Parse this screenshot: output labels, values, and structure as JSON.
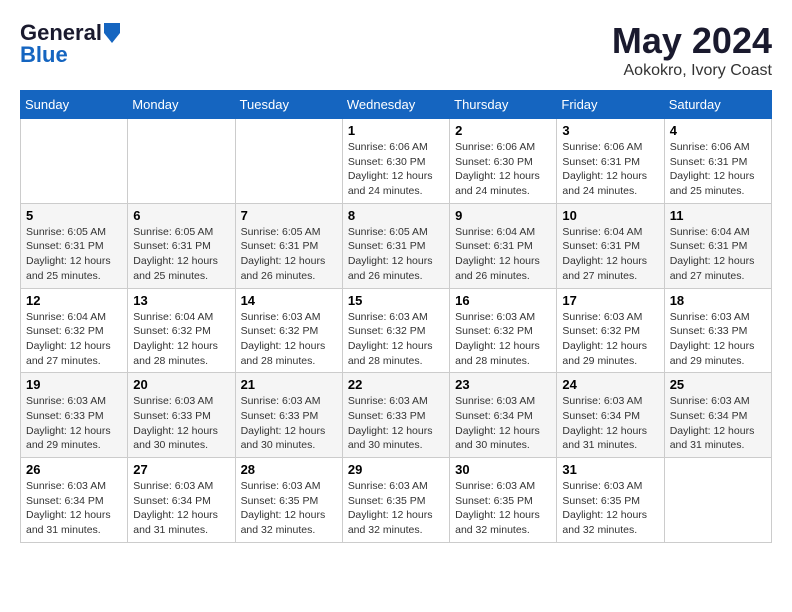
{
  "header": {
    "logo_general": "General",
    "logo_blue": "Blue",
    "month_year": "May 2024",
    "location": "Aokokro, Ivory Coast"
  },
  "days_of_week": [
    "Sunday",
    "Monday",
    "Tuesday",
    "Wednesday",
    "Thursday",
    "Friday",
    "Saturday"
  ],
  "weeks": [
    [
      {
        "day": "",
        "info": ""
      },
      {
        "day": "",
        "info": ""
      },
      {
        "day": "",
        "info": ""
      },
      {
        "day": "1",
        "info": "Sunrise: 6:06 AM\nSunset: 6:30 PM\nDaylight: 12 hours\nand 24 minutes."
      },
      {
        "day": "2",
        "info": "Sunrise: 6:06 AM\nSunset: 6:30 PM\nDaylight: 12 hours\nand 24 minutes."
      },
      {
        "day": "3",
        "info": "Sunrise: 6:06 AM\nSunset: 6:31 PM\nDaylight: 12 hours\nand 24 minutes."
      },
      {
        "day": "4",
        "info": "Sunrise: 6:06 AM\nSunset: 6:31 PM\nDaylight: 12 hours\nand 25 minutes."
      }
    ],
    [
      {
        "day": "5",
        "info": "Sunrise: 6:05 AM\nSunset: 6:31 PM\nDaylight: 12 hours\nand 25 minutes."
      },
      {
        "day": "6",
        "info": "Sunrise: 6:05 AM\nSunset: 6:31 PM\nDaylight: 12 hours\nand 25 minutes."
      },
      {
        "day": "7",
        "info": "Sunrise: 6:05 AM\nSunset: 6:31 PM\nDaylight: 12 hours\nand 26 minutes."
      },
      {
        "day": "8",
        "info": "Sunrise: 6:05 AM\nSunset: 6:31 PM\nDaylight: 12 hours\nand 26 minutes."
      },
      {
        "day": "9",
        "info": "Sunrise: 6:04 AM\nSunset: 6:31 PM\nDaylight: 12 hours\nand 26 minutes."
      },
      {
        "day": "10",
        "info": "Sunrise: 6:04 AM\nSunset: 6:31 PM\nDaylight: 12 hours\nand 27 minutes."
      },
      {
        "day": "11",
        "info": "Sunrise: 6:04 AM\nSunset: 6:31 PM\nDaylight: 12 hours\nand 27 minutes."
      }
    ],
    [
      {
        "day": "12",
        "info": "Sunrise: 6:04 AM\nSunset: 6:32 PM\nDaylight: 12 hours\nand 27 minutes."
      },
      {
        "day": "13",
        "info": "Sunrise: 6:04 AM\nSunset: 6:32 PM\nDaylight: 12 hours\nand 28 minutes."
      },
      {
        "day": "14",
        "info": "Sunrise: 6:03 AM\nSunset: 6:32 PM\nDaylight: 12 hours\nand 28 minutes."
      },
      {
        "day": "15",
        "info": "Sunrise: 6:03 AM\nSunset: 6:32 PM\nDaylight: 12 hours\nand 28 minutes."
      },
      {
        "day": "16",
        "info": "Sunrise: 6:03 AM\nSunset: 6:32 PM\nDaylight: 12 hours\nand 28 minutes."
      },
      {
        "day": "17",
        "info": "Sunrise: 6:03 AM\nSunset: 6:32 PM\nDaylight: 12 hours\nand 29 minutes."
      },
      {
        "day": "18",
        "info": "Sunrise: 6:03 AM\nSunset: 6:33 PM\nDaylight: 12 hours\nand 29 minutes."
      }
    ],
    [
      {
        "day": "19",
        "info": "Sunrise: 6:03 AM\nSunset: 6:33 PM\nDaylight: 12 hours\nand 29 minutes."
      },
      {
        "day": "20",
        "info": "Sunrise: 6:03 AM\nSunset: 6:33 PM\nDaylight: 12 hours\nand 30 minutes."
      },
      {
        "day": "21",
        "info": "Sunrise: 6:03 AM\nSunset: 6:33 PM\nDaylight: 12 hours\nand 30 minutes."
      },
      {
        "day": "22",
        "info": "Sunrise: 6:03 AM\nSunset: 6:33 PM\nDaylight: 12 hours\nand 30 minutes."
      },
      {
        "day": "23",
        "info": "Sunrise: 6:03 AM\nSunset: 6:34 PM\nDaylight: 12 hours\nand 30 minutes."
      },
      {
        "day": "24",
        "info": "Sunrise: 6:03 AM\nSunset: 6:34 PM\nDaylight: 12 hours\nand 31 minutes."
      },
      {
        "day": "25",
        "info": "Sunrise: 6:03 AM\nSunset: 6:34 PM\nDaylight: 12 hours\nand 31 minutes."
      }
    ],
    [
      {
        "day": "26",
        "info": "Sunrise: 6:03 AM\nSunset: 6:34 PM\nDaylight: 12 hours\nand 31 minutes."
      },
      {
        "day": "27",
        "info": "Sunrise: 6:03 AM\nSunset: 6:34 PM\nDaylight: 12 hours\nand 31 minutes."
      },
      {
        "day": "28",
        "info": "Sunrise: 6:03 AM\nSunset: 6:35 PM\nDaylight: 12 hours\nand 32 minutes."
      },
      {
        "day": "29",
        "info": "Sunrise: 6:03 AM\nSunset: 6:35 PM\nDaylight: 12 hours\nand 32 minutes."
      },
      {
        "day": "30",
        "info": "Sunrise: 6:03 AM\nSunset: 6:35 PM\nDaylight: 12 hours\nand 32 minutes."
      },
      {
        "day": "31",
        "info": "Sunrise: 6:03 AM\nSunset: 6:35 PM\nDaylight: 12 hours\nand 32 minutes."
      },
      {
        "day": "",
        "info": ""
      }
    ]
  ]
}
